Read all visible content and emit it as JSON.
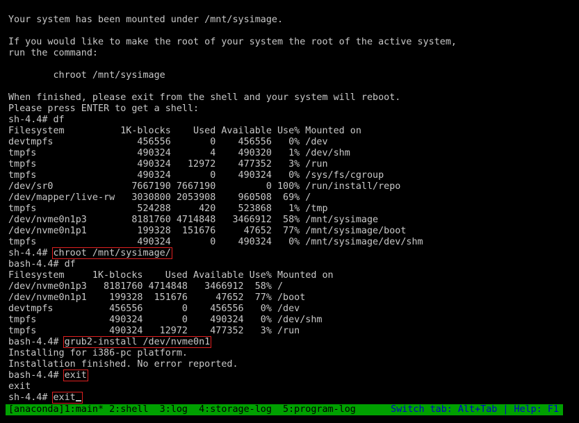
{
  "terminal": {
    "lines": [
      {
        "text": "Your system has been mounted under /mnt/sysimage."
      },
      {
        "text": ""
      },
      {
        "text": "If you would like to make the root of your system the root of the active system,"
      },
      {
        "text": "run the command:"
      },
      {
        "text": ""
      },
      {
        "text": "        chroot /mnt/sysimage"
      },
      {
        "text": ""
      },
      {
        "text": "When finished, please exit from the shell and your system will reboot."
      },
      {
        "text": "Please press ENTER to get a shell:"
      },
      {
        "text": "sh-4.4# df"
      },
      {
        "text": "Filesystem          1K-blocks    Used Available Use% Mounted on"
      },
      {
        "text": "devtmpfs               456556       0    456556   0% /dev"
      },
      {
        "text": "tmpfs                  490324       4    490320   1% /dev/shm"
      },
      {
        "text": "tmpfs                  490324   12972    477352   3% /run"
      },
      {
        "text": "tmpfs                  490324       0    490324   0% /sys/fs/cgroup"
      },
      {
        "text": "/dev/sr0              7667190 7667190         0 100% /run/install/repo"
      },
      {
        "text": "/dev/mapper/live-rw   3030800 2053908    960508  69% /"
      },
      {
        "text": "tmpfs                  524288     420    523868   1% /tmp"
      },
      {
        "text": "/dev/nvme0n1p3        8181760 4714848   3466912  58% /mnt/sysimage"
      },
      {
        "text": "/dev/nvme0n1p1         199328  151676     47652  77% /mnt/sysimage/boot"
      },
      {
        "text": "tmpfs                  490324       0    490324   0% /mnt/sysimage/dev/shm"
      },
      {
        "prompt": "sh-4.4# ",
        "cmd": "chroot /mnt/sysimage/",
        "boxed": true
      },
      {
        "text": "bash-4.4# df"
      },
      {
        "text": "Filesystem     1K-blocks    Used Available Use% Mounted on"
      },
      {
        "text": "/dev/nvme0n1p3   8181760 4714848   3466912  58% /"
      },
      {
        "text": "/dev/nvme0n1p1    199328  151676     47652  77% /boot"
      },
      {
        "text": "devtmpfs          456556       0    456556   0% /dev"
      },
      {
        "text": "tmpfs             490324       0    490324   0% /dev/shm"
      },
      {
        "text": "tmpfs             490324   12972    477352   3% /run"
      },
      {
        "prompt": "bash-4.4# ",
        "cmd": "grub2-install /dev/nvme0n1",
        "boxed": true
      },
      {
        "text": "Installing for i386-pc platform."
      },
      {
        "text": "Installation finished. No error reported."
      },
      {
        "prompt": "bash-4.4# ",
        "cmd": "exit",
        "boxed": true
      },
      {
        "text": "exit"
      },
      {
        "prompt": "sh-4.4# ",
        "cmd": "exit",
        "boxed": true,
        "cursor": true
      }
    ]
  },
  "statusbar": {
    "left": "[anaconda]1:main* 2:shell  3:log  4:storage-log  5:program-log",
    "right": "Switch tab: Alt+Tab | Help: F1"
  },
  "colors": {
    "background": "#000000",
    "text": "#c8c8c8",
    "highlight_box": "#e02020",
    "statusbar_bg": "#00a000",
    "statusbar_right_text": "#0000c8"
  }
}
